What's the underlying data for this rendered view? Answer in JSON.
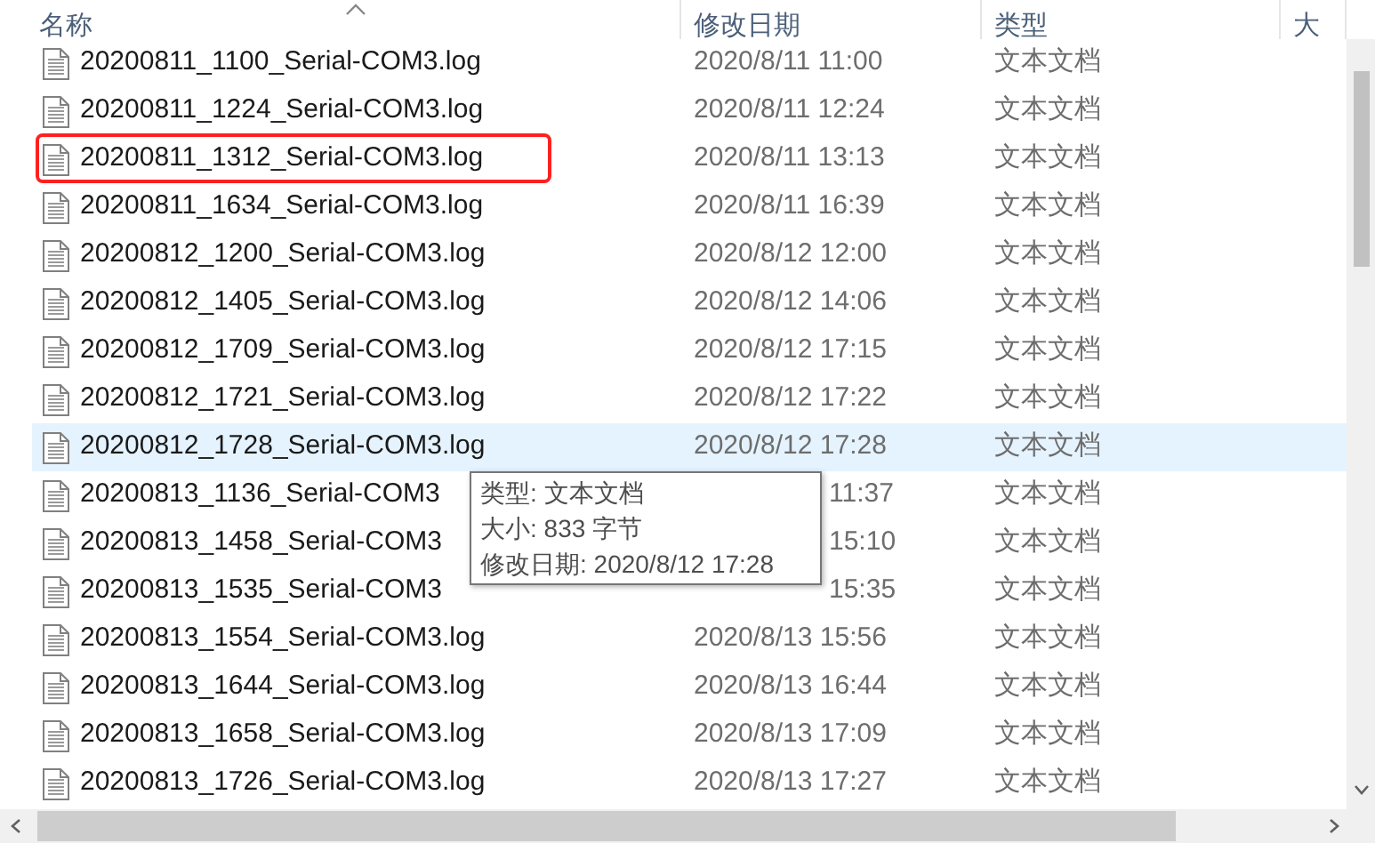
{
  "header": {
    "columns": [
      "名称",
      "修改日期",
      "类型",
      "大"
    ]
  },
  "rows": [
    {
      "name": "20200811_1100_Serial-COM3.log",
      "date": "2020/8/11 11:00",
      "type": "文本文档",
      "hovered": false,
      "annotated": false,
      "kind": "normal"
    },
    {
      "name": "20200811_1224_Serial-COM3.log",
      "date": "2020/8/11 12:24",
      "type": "文本文档",
      "hovered": false,
      "annotated": false,
      "kind": "normal"
    },
    {
      "name": "20200811_1312_Serial-COM3.log",
      "date": "2020/8/11 13:13",
      "type": "文本文档",
      "hovered": false,
      "annotated": true,
      "kind": "normal"
    },
    {
      "name": "20200811_1634_Serial-COM3.log",
      "date": "2020/8/11 16:39",
      "type": "文本文档",
      "hovered": false,
      "annotated": false,
      "kind": "normal"
    },
    {
      "name": "20200812_1200_Serial-COM3.log",
      "date": "2020/8/12 12:00",
      "type": "文本文档",
      "hovered": false,
      "annotated": false,
      "kind": "normal"
    },
    {
      "name": "20200812_1405_Serial-COM3.log",
      "date": "2020/8/12 14:06",
      "type": "文本文档",
      "hovered": false,
      "annotated": false,
      "kind": "normal"
    },
    {
      "name": "20200812_1709_Serial-COM3.log",
      "date": "2020/8/12 17:15",
      "type": "文本文档",
      "hovered": false,
      "annotated": false,
      "kind": "normal"
    },
    {
      "name": "20200812_1721_Serial-COM3.log",
      "date": "2020/8/12 17:22",
      "type": "文本文档",
      "hovered": false,
      "annotated": false,
      "kind": "normal"
    },
    {
      "name": "20200812_1728_Serial-COM3.log",
      "date": "2020/8/12 17:28",
      "type": "文本文档",
      "hovered": true,
      "annotated": false,
      "kind": "normal"
    },
    {
      "name": "20200813_1136_Serial-COM3",
      "date": "11:37",
      "type": "文本文档",
      "hovered": false,
      "annotated": false,
      "kind": "covered"
    },
    {
      "name": "20200813_1458_Serial-COM3",
      "date": "15:10",
      "type": "文本文档",
      "hovered": false,
      "annotated": false,
      "kind": "covered"
    },
    {
      "name": "20200813_1535_Serial-COM3",
      "date": "15:35",
      "type": "文本文档",
      "hovered": false,
      "annotated": false,
      "kind": "covered"
    },
    {
      "name": "20200813_1554_Serial-COM3.log",
      "date": "2020/8/13 15:56",
      "type": "文本文档",
      "hovered": false,
      "annotated": false,
      "kind": "normal"
    },
    {
      "name": "20200813_1644_Serial-COM3.log",
      "date": "2020/8/13 16:44",
      "type": "文本文档",
      "hovered": false,
      "annotated": false,
      "kind": "normal"
    },
    {
      "name": "20200813_1658_Serial-COM3.log",
      "date": "2020/8/13 17:09",
      "type": "文本文档",
      "hovered": false,
      "annotated": false,
      "kind": "normal"
    },
    {
      "name": "20200813_1726_Serial-COM3.log",
      "date": "2020/8/13 17:27",
      "type": "文本文档",
      "hovered": false,
      "annotated": false,
      "kind": "normal"
    }
  ],
  "tooltip": {
    "lines": [
      "类型: 文本文档",
      "大小: 833 字节",
      "修改日期: 2020/8/12 17:28"
    ]
  }
}
